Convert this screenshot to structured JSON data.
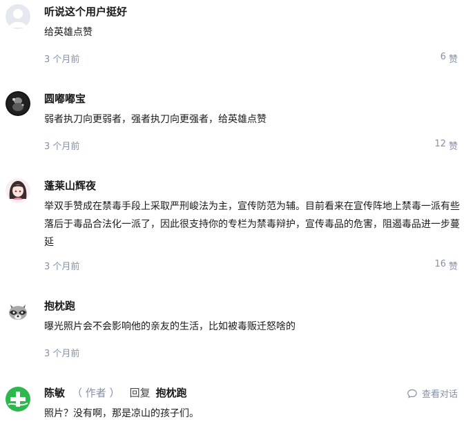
{
  "comments": [
    {
      "author": "听说这个用户挺好",
      "content": "给英雄点赞",
      "time": "3 个月前",
      "likes": "6",
      "like_label": "赞",
      "avatar_icon": "default-user-avatar-icon"
    },
    {
      "author": "圆嘟嘟宝",
      "content": "弱者执刀向更弱者，强者执刀向更强者，给英雄点赞",
      "time": "3 个月前",
      "likes": "12",
      "like_label": "赞",
      "avatar_icon": "dark-photo-avatar-icon"
    },
    {
      "author": "蓬莱山辉夜",
      "content": "举双手赞成在禁毒手段上采取严刑峻法为主，宣传防范为辅。目前看来在宣传阵地上禁毒一派有些落后于毒品合法化一派了，因此很支持你的专栏为禁毒辩护，宣传毒品的危害，阻遏毒品进一步蔓延",
      "time": "3 个月前",
      "likes": "16",
      "like_label": "赞",
      "avatar_icon": "anime-girl-avatar-icon"
    },
    {
      "author": "抱枕跑",
      "content": "曝光照片会不会影响他的亲友的生活，比如被毒贩迁怒啥的",
      "time": "3 个月前",
      "avatar_icon": "raccoon-avatar-icon"
    },
    {
      "author": "陈敏",
      "role": "（ 作者 ）",
      "reply_word": "回复",
      "reply_to": "抱枕跑",
      "content": "照片？没有啊，那是凉山的孩子们。",
      "view_dialog": "查看对话",
      "avatar_icon": "green-plus-avatar-icon"
    }
  ],
  "colors": {
    "text": "#1a1a1a",
    "meta": "#8590a6",
    "green": "#2db84b"
  }
}
